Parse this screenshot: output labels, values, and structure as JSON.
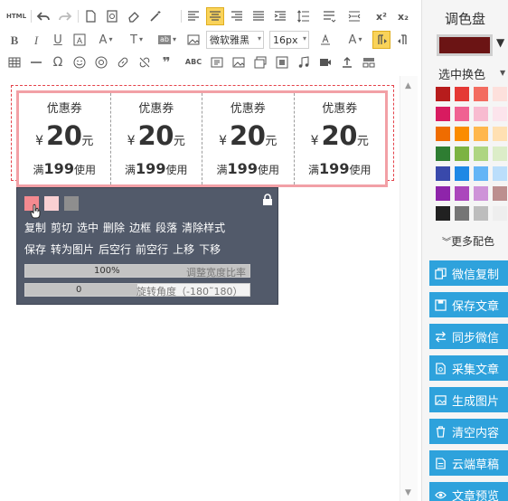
{
  "toolbar": {
    "html_label": "HTML",
    "font_family": "微软雅黑",
    "font_size": "16px",
    "spell_label": "ABC"
  },
  "coupons": [
    {
      "title": "优惠券",
      "currency": "¥",
      "amount": "20",
      "unit": "元",
      "cond_pre": "满",
      "min": "199",
      "cond_post": "使用"
    },
    {
      "title": "优惠券",
      "currency": "¥",
      "amount": "20",
      "unit": "元",
      "cond_pre": "满",
      "min": "199",
      "cond_post": "使用"
    },
    {
      "title": "优惠券",
      "currency": "¥",
      "amount": "20",
      "unit": "元",
      "cond_pre": "满",
      "min": "199",
      "cond_post": "使用"
    },
    {
      "title": "优惠券",
      "currency": "¥",
      "amount": "20",
      "unit": "元",
      "cond_pre": "满",
      "min": "199",
      "cond_post": "使用"
    }
  ],
  "context_toolbar": {
    "swatches": [
      "#f48a90",
      "#f9d0d2",
      "#8e8e8e"
    ],
    "row1": [
      "复制",
      "剪切",
      "选中",
      "删除",
      "边框",
      "段落",
      "清除样式"
    ],
    "row2": [
      "保存",
      "转为图片",
      "后空行",
      "前空行",
      "上移",
      "下移"
    ],
    "width_value": "100%",
    "width_label": "调整宽度比率",
    "rotate_value": "0",
    "rotate_label": "旋转角度（-180˜180）"
  },
  "panel": {
    "title": "调色盘",
    "current_color": "#6b1414",
    "select_swap": "选中换色",
    "more_colors": "更多配色",
    "palette": [
      [
        "#b71c1c",
        "#e53935",
        "#f36c60",
        "#fde0dc"
      ],
      [
        "#d81b60",
        "#f06292",
        "#f8bbd0",
        "#fce4ec"
      ],
      [
        "#ef6c00",
        "#fb8c00",
        "#ffb74d",
        "#ffe0b2"
      ],
      [
        "#2e7d32",
        "#7cb342",
        "#aed581",
        "#dcedc8"
      ],
      [
        "#3949ab",
        "#1e88e5",
        "#64b5f6",
        "#bbdefb"
      ],
      [
        "#8e24aa",
        "#ab47bc",
        "#ce93d8",
        "#bc8f8f"
      ],
      [
        "#212121",
        "#757575",
        "#bdbdbd",
        "#eeeeee"
      ]
    ],
    "actions": [
      "微信复制",
      "保存文章",
      "同步微信",
      "采集文章",
      "生成图片",
      "清空内容",
      "云端草稿",
      "文章预览"
    ]
  }
}
